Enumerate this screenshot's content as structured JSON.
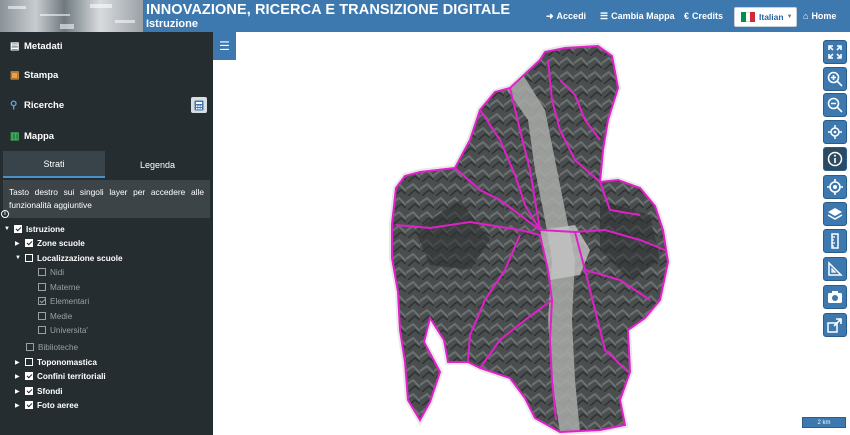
{
  "header": {
    "title": "INNOVAZIONE, RICERCA E TRANSIZIONE DIGITALE",
    "subtitle": "Istruzione",
    "buttons": {
      "accedi": "Accedi",
      "cambia_mappa": "Cambia Mappa",
      "credits": "Credits",
      "home": "Home"
    },
    "language": "Italian",
    "colors": {
      "bar": "#3d78ae"
    }
  },
  "sidebar": {
    "menu": {
      "metadati": "Metadati",
      "stampa": "Stampa",
      "ricerche": "Ricerche",
      "mappa": "Mappa"
    },
    "tabs": {
      "strati": "Strati",
      "legenda": "Legenda"
    },
    "hint": "Tasto destro sui singoli layer per accedere alle funzionalità aggiuntive",
    "tree": {
      "istruzione": "Istruzione",
      "zone_scuole": "Zone scuole",
      "localizzazione": "Localizzazione scuole",
      "nidi": "Nidi",
      "materne": "Materne",
      "elementari": "Elementari",
      "medie": "Medie",
      "universita": "Universita'",
      "biblioteche": "Biblioteche",
      "toponomastica": "Toponomastica",
      "confini": "Confini territoriali",
      "sfondi": "Sfondi",
      "foto_aeree": "Foto aeree"
    }
  },
  "map": {
    "scale_label": "2 km",
    "boundary_color": "#e020c8"
  }
}
